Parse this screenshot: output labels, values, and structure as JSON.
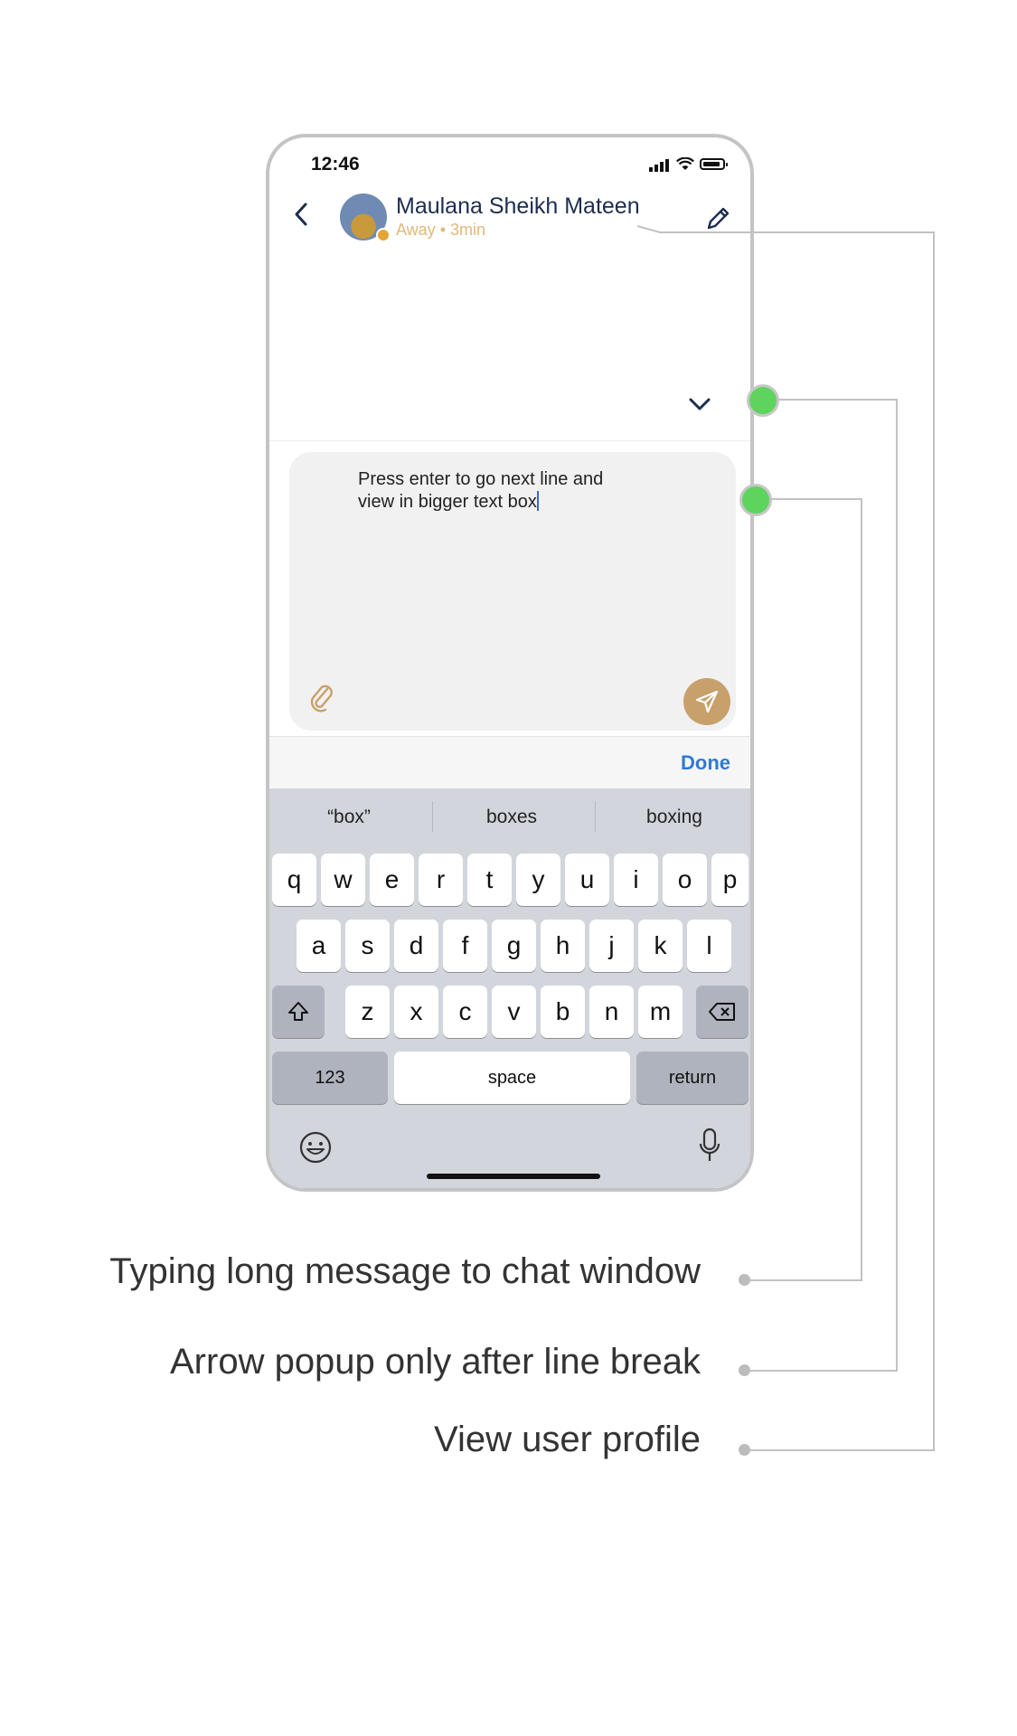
{
  "status_bar": {
    "time": "12:46"
  },
  "header": {
    "contact_name": "Maulana Sheikh Mateen",
    "contact_status": "Away • 3min"
  },
  "composer": {
    "line1": "Press enter to go next line and",
    "line2": "view in bigger text box"
  },
  "toolbar": {
    "done_label": "Done"
  },
  "keyboard": {
    "suggestions": [
      "“box”",
      "boxes",
      "boxing"
    ],
    "row1": [
      "q",
      "w",
      "e",
      "r",
      "t",
      "y",
      "u",
      "i",
      "o",
      "p"
    ],
    "row2": [
      "a",
      "s",
      "d",
      "f",
      "g",
      "h",
      "j",
      "k",
      "l"
    ],
    "row3": [
      "z",
      "x",
      "c",
      "v",
      "b",
      "n",
      "m"
    ],
    "numbers_label": "123",
    "space_label": "space",
    "return_label": "return"
  },
  "annotations": {
    "typing": "Typing long message to chat window",
    "arrow": "Arrow popup only after line break",
    "profile": "View user profile"
  },
  "colors": {
    "accent_green": "#5ed45e",
    "send_button": "#c8a06b",
    "done_blue": "#2f7ad1"
  }
}
